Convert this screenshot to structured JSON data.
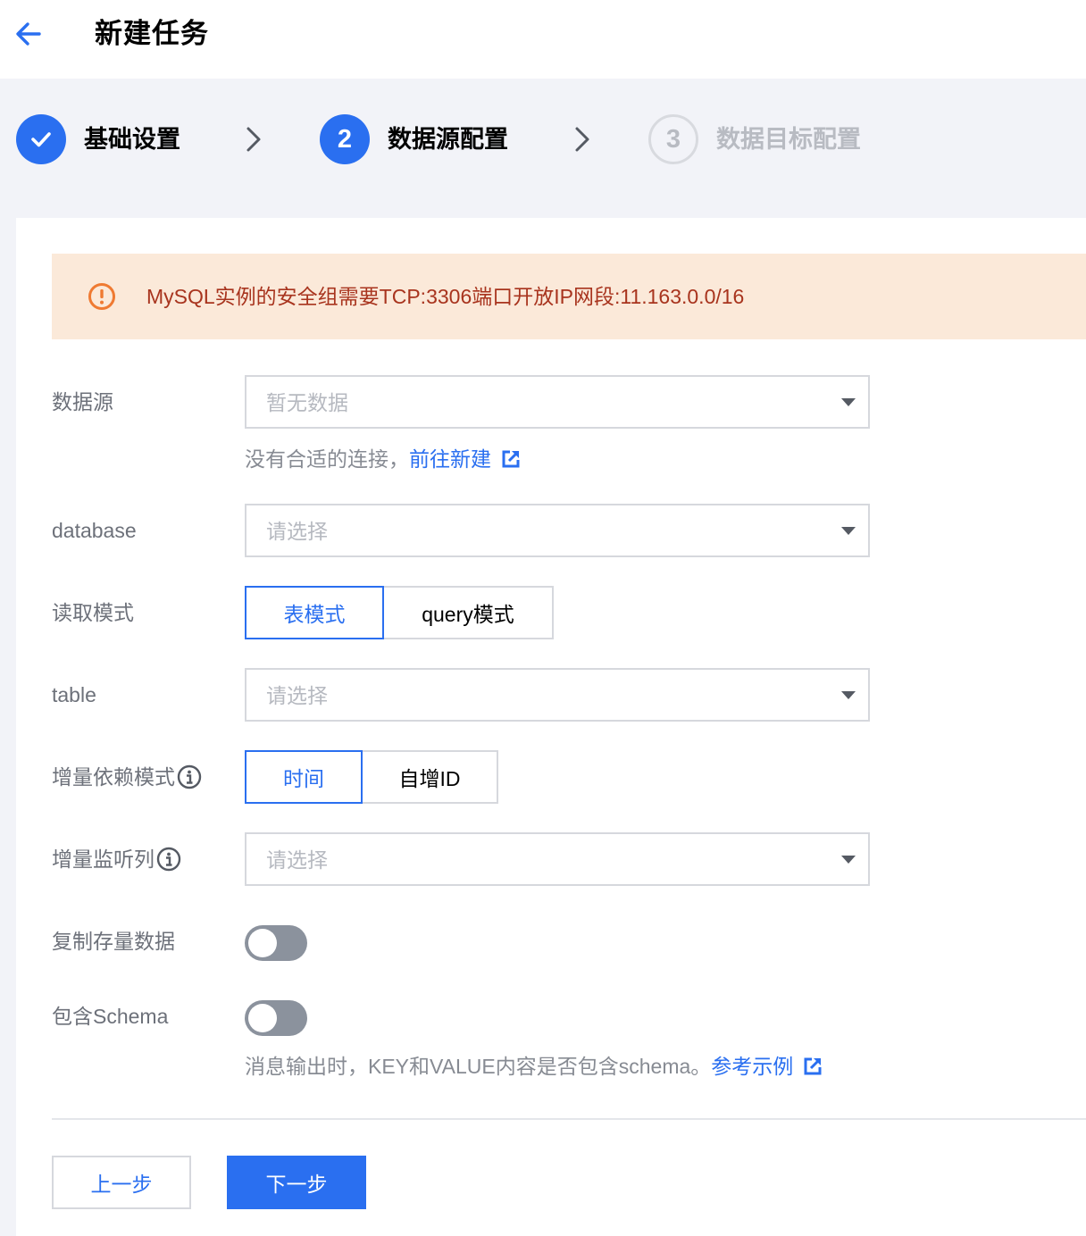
{
  "header": {
    "title": "新建任务"
  },
  "steps": [
    {
      "number": "",
      "label": "基础设置",
      "state": "done"
    },
    {
      "number": "2",
      "label": "数据源配置",
      "state": "active"
    },
    {
      "number": "3",
      "label": "数据目标配置",
      "state": "pending"
    }
  ],
  "alert": {
    "text": "MySQL实例的安全组需要TCP:3306端口开放IP网段:11.163.0.0/16"
  },
  "form": {
    "datasource": {
      "label": "数据源",
      "placeholder": "暂无数据",
      "hint": "没有合适的连接，",
      "hint_link": "前往新建"
    },
    "database": {
      "label": "database",
      "placeholder": "请选择"
    },
    "read_mode": {
      "label": "读取模式",
      "options": [
        "表模式",
        "query模式"
      ],
      "selected": "表模式"
    },
    "table": {
      "label": "table",
      "placeholder": "请选择"
    },
    "incremental_mode": {
      "label": "增量依赖模式",
      "options": [
        "时间",
        "自增ID"
      ],
      "selected": "时间"
    },
    "incremental_column": {
      "label": "增量监听列",
      "placeholder": "请选择"
    },
    "copy_existing": {
      "label": "复制存量数据",
      "enabled": false
    },
    "include_schema": {
      "label": "包含Schema",
      "enabled": false,
      "hint": "消息输出时，KEY和VALUE内容是否包含schema。",
      "hint_link": "参考示例"
    }
  },
  "footer": {
    "prev_label": "上一步",
    "next_label": "下一步"
  },
  "colors": {
    "accent": "#2a6ff0",
    "alert_bg": "#fbe9d9",
    "alert_text": "#a8341e",
    "toggle_off": "#8b929d"
  },
  "icons": [
    "arrow-left-icon",
    "check-icon",
    "chevron-right-icon",
    "warning-circle-icon",
    "external-link-icon",
    "info-circle-icon",
    "caret-down-icon"
  ]
}
